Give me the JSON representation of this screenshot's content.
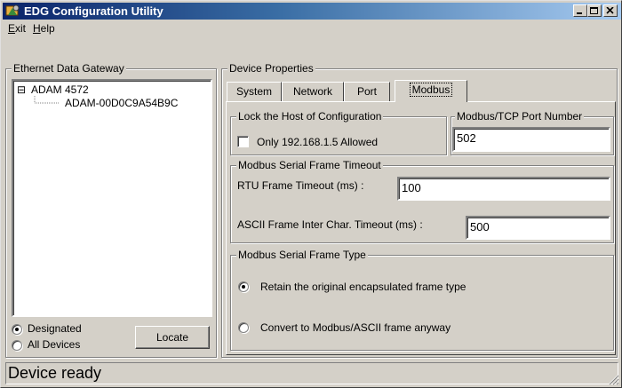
{
  "window": {
    "title": "EDG Configuration Utility",
    "buttons": {
      "minimize": "minimize",
      "maximize": "maximize",
      "close": "close"
    }
  },
  "menu": [
    {
      "label": "Exit",
      "mnemonic": "E",
      "rest": "xit"
    },
    {
      "label": "Help",
      "mnemonic": "H",
      "rest": "elp"
    }
  ],
  "gateway_panel": {
    "title": "Ethernet Data Gateway",
    "tree": {
      "root": {
        "expander": "⊟",
        "label": "ADAM 4572"
      },
      "child": {
        "label": "ADAM-00D0C9A54B9C"
      }
    },
    "radios": [
      {
        "label": "Designated",
        "selected": true
      },
      {
        "label": "All Devices",
        "selected": false
      }
    ],
    "locate_button": "Locate"
  },
  "device_panel": {
    "title": "Device Properties",
    "tabs": [
      {
        "label": "System",
        "active": false
      },
      {
        "label": "Network",
        "active": false
      },
      {
        "label": "Port",
        "active": false
      },
      {
        "label": "Modbus",
        "active": true
      }
    ],
    "lock_group": {
      "title": "Lock the Host of Configuration",
      "checkbox_label": "Only 192.168.1.5 Allowed",
      "checked": false
    },
    "port_group": {
      "title": "Modbus/TCP Port Number",
      "value": "502"
    },
    "timeout_group": {
      "title": "Modbus Serial Frame Timeout",
      "rtu_label": "RTU Frame Timeout (ms) :",
      "rtu_value": "100",
      "ascii_label": "ASCII Frame Inter Char. Timeout (ms) :",
      "ascii_value": "500"
    },
    "frame_group": {
      "title": "Modbus Serial Frame Type",
      "options": [
        {
          "label": "Retain the original encapsulated frame type",
          "selected": true
        },
        {
          "label": "Convert to Modbus/ASCII frame anyway",
          "selected": false
        }
      ]
    }
  },
  "status": {
    "text": "Device ready"
  }
}
